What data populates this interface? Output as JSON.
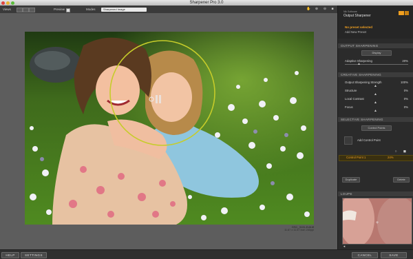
{
  "window": {
    "title": "Sharpener Pro 3.0"
  },
  "toolbar": {
    "views_label": "Views",
    "preview_label": "Preview",
    "modes_label": "Modes",
    "mode_value": "Sharpened Image"
  },
  "image_info": {
    "filename": "DSC_3131-Edit.tif",
    "dimensions": "11.67 x 11.67 inch 240ppi"
  },
  "panel": {
    "brand_small": "Nik Software",
    "brand_title": "Output Sharpener",
    "no_preset": "No preset selected",
    "add_preset": "Add New Preset",
    "output_sharpening": {
      "header": "OUTPUT SHARPENING",
      "display_select": "Display",
      "adaptive_label": "Adaptive Sharpening",
      "adaptive_value": "20%"
    },
    "creative_sharpening": {
      "header": "CREATIVE SHARPENING",
      "rows": [
        {
          "label": "Output Sharpening Strength",
          "value": "100%"
        },
        {
          "label": "Structure",
          "value": "0%"
        },
        {
          "label": "Local Contrast",
          "value": "0%"
        },
        {
          "label": "Focus",
          "value": "0%"
        }
      ]
    },
    "selective_sharpening": {
      "header": "SELECTIVE SHARPENING",
      "select_value": "Control Points",
      "add_cp": "Add Control Point",
      "cp_name": "Control Point 1",
      "cp_value": "24%",
      "duplicate": "Duplicate",
      "delete": "Delete"
    },
    "loupe": {
      "header": "LOUPE"
    }
  },
  "bottom": {
    "help": "HELP",
    "settings": "SETTINGS",
    "cancel": "CANCEL",
    "save": "SAVE"
  },
  "colors": {
    "accent": "#f0a020",
    "control_point_ring": "#c6cc2a"
  }
}
